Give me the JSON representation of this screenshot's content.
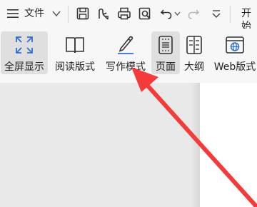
{
  "menubar": {
    "menu_icon": "hamburger-menu-icon",
    "file_menu_label": "文件",
    "chevron_icon": "chevron-down-icon",
    "quick_icons": [
      "save-icon",
      "export-icon",
      "print-icon",
      "print-preview-icon",
      "undo-icon",
      "redo-icon",
      "more-options-icon"
    ],
    "start_tab_label": "开始"
  },
  "ribbon": {
    "buttons": [
      {
        "label": "全屏显示",
        "icon": "fullscreen-icon",
        "active": true
      },
      {
        "label": "阅读版式",
        "icon": "reading-layout-icon",
        "active": false
      },
      {
        "label": "写作模式",
        "icon": "writing-mode-icon",
        "active": false
      },
      {
        "label": "页面",
        "icon": "page-view-icon",
        "active": true
      },
      {
        "label": "大纲",
        "icon": "outline-icon",
        "active": false
      },
      {
        "label": "Web版式",
        "icon": "web-layout-icon",
        "active": false
      }
    ]
  },
  "colors": {
    "accent": "#2f6fd6",
    "arrow": "#f53a3a",
    "toolbar_bg": "#f7f7f7",
    "doc_bg": "#e9e9e9"
  }
}
